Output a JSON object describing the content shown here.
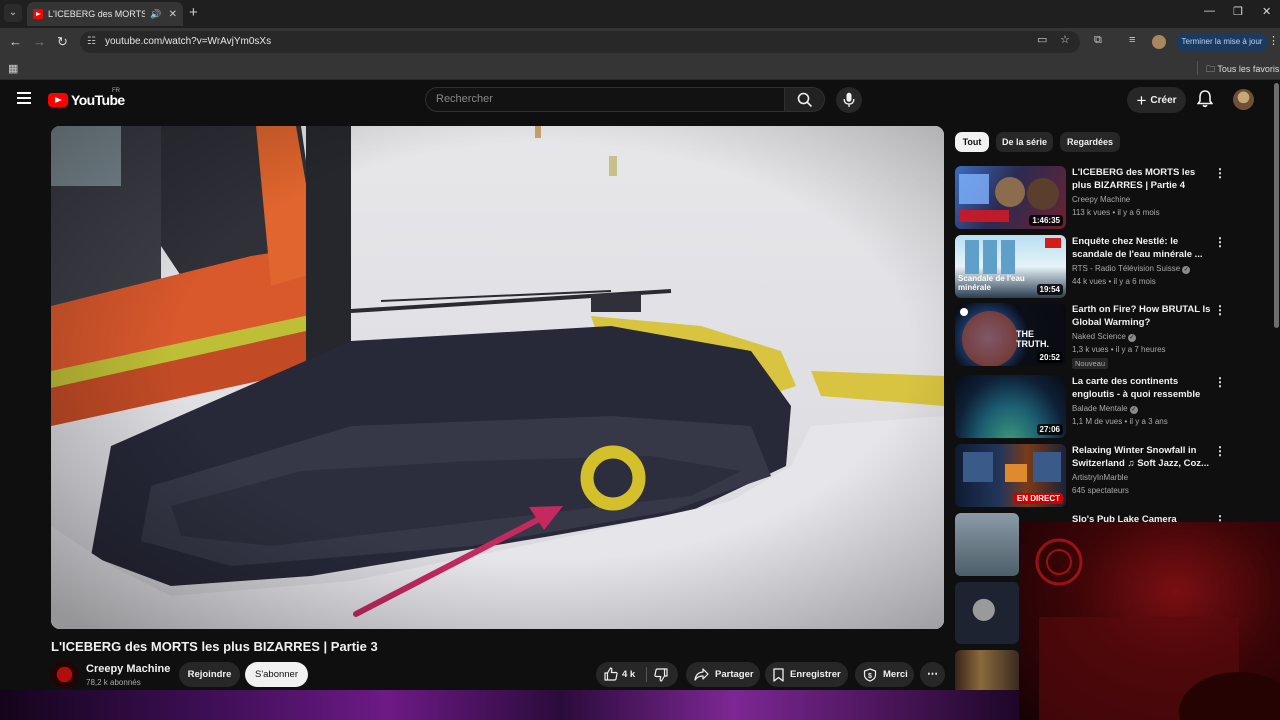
{
  "browser": {
    "tab_title": "L'ICEBERG des MORTS les plus BIZARRES | Partie 3",
    "url": "youtube.com/watch?v=WrAvjYm0sXs",
    "update_button": "Terminer la mise à jour",
    "bookmarks_all": "Tous les favoris",
    "new_tab_symbol": "+"
  },
  "header": {
    "logo_text": "YouTube",
    "country_code": "FR",
    "search_placeholder": "Rechercher",
    "create_label": "Créer"
  },
  "video": {
    "title": "L'ICEBERG des MORTS les plus BIZARRES | Partie 3",
    "channel": "Creepy Machine",
    "subscribers": "78,2 k abonnés",
    "join_label": "Rejoindre",
    "subscribe_label": "S'abonner",
    "likes": "4 k",
    "share_label": "Partager",
    "save_label": "Enregistrer",
    "thanks_label": "Merci"
  },
  "chips": [
    "Tout",
    "De la série",
    "Regardées"
  ],
  "recommendations": [
    {
      "title": "L'ICEBERG des MORTS les plus BIZARRES | Partie 4",
      "channel": "Creepy Machine",
      "verified": false,
      "meta": "113 k vues • il y a 6 mois",
      "duration": "1:46:35"
    },
    {
      "title": "Enquête chez Nestlé: le scandale de l'eau minérale ...",
      "channel": "RTS - Radio Télévision Suisse",
      "verified": true,
      "meta": "44 k vues • il y a 6 mois",
      "duration": "19:54",
      "thumb_text": "Scandale de l'eau minérale"
    },
    {
      "title": "Earth on Fire? How BRUTAL Is Global Warming?",
      "channel": "Naked Science",
      "verified": true,
      "meta": "1,3 k vues • il y a 7 heures",
      "badge": "Nouveau",
      "duration": "20:52",
      "thumb_text": "THE TRUTH."
    },
    {
      "title": "La carte des continents engloutis - à quoi ressemble la...",
      "channel": "Balade Mentale",
      "verified": true,
      "meta": "1,1 M de vues • il y a 3 ans",
      "duration": "27:06"
    },
    {
      "title": "Relaxing Winter Snowfall in Switzerland ♫ Soft Jazz, Coz...",
      "channel": "ArtistryInMarble",
      "verified": false,
      "meta": "645 spectateurs",
      "live": "EN DIRECT"
    },
    {
      "title": "Slo's Pub Lake Camera",
      "channel": "",
      "meta": ""
    }
  ],
  "colors": {
    "youtube_red": "#ff0000",
    "background": "#0f0f0f",
    "chip_bg": "#272727",
    "annotation_circle": "#d4c02a",
    "annotation_arrow": "#c4295f"
  }
}
